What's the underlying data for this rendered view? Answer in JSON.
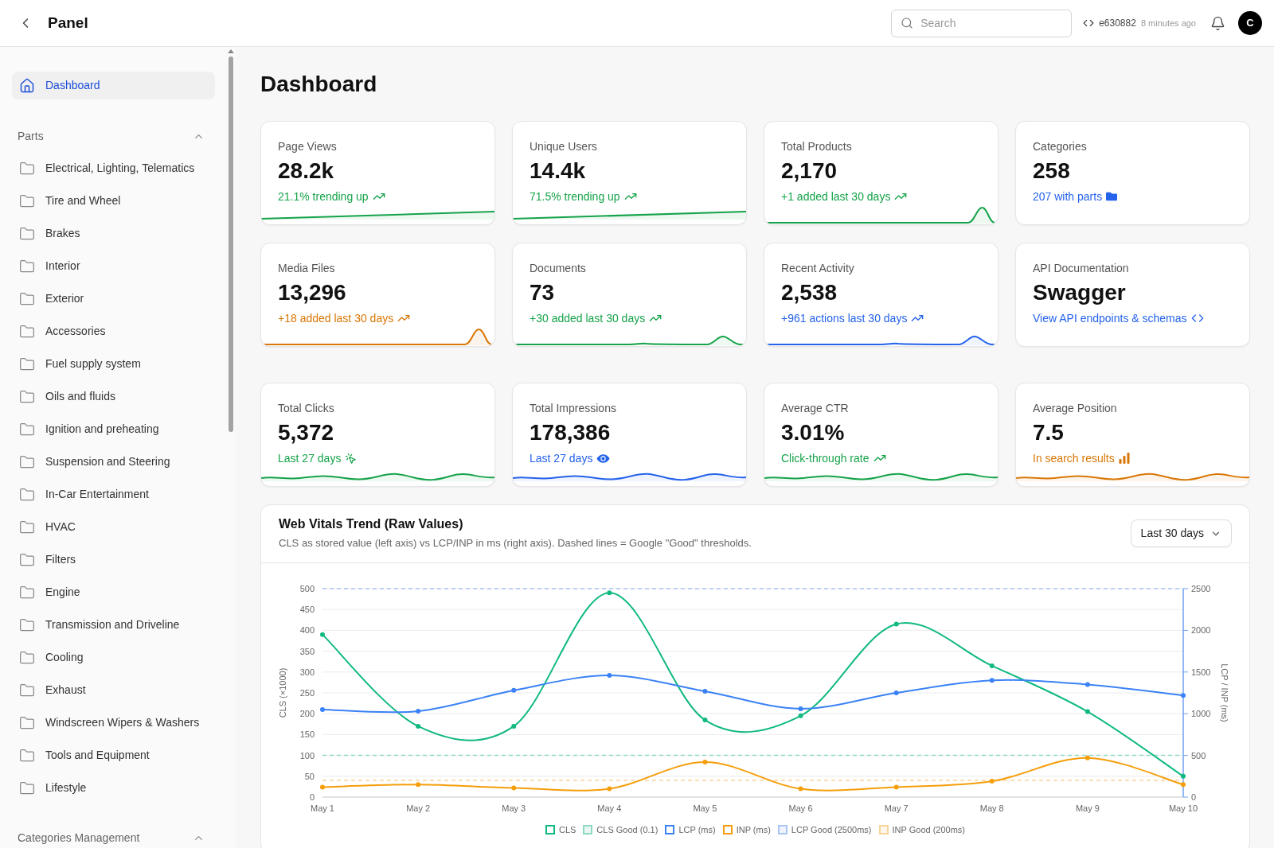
{
  "header": {
    "title": "Panel",
    "search": {
      "placeholder": "Search"
    },
    "commit": "e630882",
    "updated": "8 minutes ago",
    "avatar": "C"
  },
  "sidebar": {
    "items": [
      {
        "label": "Dashboard",
        "selected": true
      }
    ],
    "sections": [
      {
        "title": "Parts",
        "expanded": true,
        "items": [
          {
            "label": "Electrical, Lighting, Telematics",
            "selected": false
          },
          {
            "label": "Tire and Wheel",
            "selected": false
          },
          {
            "label": "Brakes",
            "selected": false
          },
          {
            "label": "Interior",
            "selected": false
          },
          {
            "label": "Exterior",
            "selected": false
          },
          {
            "label": "Accessories",
            "selected": false
          },
          {
            "label": "Fuel supply system",
            "selected": false
          },
          {
            "label": "Oils and fluids",
            "selected": false
          },
          {
            "label": "Ignition and preheating",
            "selected": false
          },
          {
            "label": "Suspension and Steering",
            "selected": false
          },
          {
            "label": "In-Car Entertainment",
            "selected": false
          },
          {
            "label": "HVAC",
            "selected": false
          },
          {
            "label": "Filters",
            "selected": false
          },
          {
            "label": "Engine",
            "selected": false
          },
          {
            "label": "Transmission and Driveline",
            "selected": false
          },
          {
            "label": "Cooling",
            "selected": false
          },
          {
            "label": "Exhaust",
            "selected": false
          },
          {
            "label": "Windscreen Wipers & Washers",
            "selected": false
          },
          {
            "label": "Tools and Equipment",
            "selected": false
          },
          {
            "label": "Lifestyle",
            "selected": false
          }
        ]
      },
      {
        "title": "Categories Management",
        "expanded": true
      }
    ]
  },
  "page": {
    "title": "Dashboard"
  },
  "overview_cards": [
    {
      "kind": "trend",
      "label": "Page Views",
      "value": "28.2k",
      "note": "21.1% trending up",
      "color": "#16a34a",
      "sparkline": {
        "kind": "rise"
      }
    },
    {
      "kind": "trend",
      "label": "Unique Users",
      "value": "14.4k",
      "note": "71.5% trending up",
      "color": "#16a34a",
      "sparkline": {
        "kind": "rise"
      }
    },
    {
      "kind": "trend",
      "label": "Total Products",
      "value": "2,170",
      "note": "+1 added last 30 days",
      "color": "#16a34a",
      "sparkline": {
        "kind": "spike"
      }
    },
    {
      "kind": "categories",
      "label": "Categories",
      "value": "258",
      "note": "207 with parts",
      "color": "#2563eb"
    },
    {
      "kind": "trend",
      "label": "Media Files",
      "value": "13,296",
      "note": "+18 added last 30 days",
      "color": "#d97706",
      "sparkline": {
        "kind": "spike"
      }
    },
    {
      "kind": "trend",
      "label": "Documents",
      "value": "73",
      "note": "+30 added last 30 days",
      "color": "#16a34a",
      "sparkline": {
        "kind": "bump"
      }
    },
    {
      "kind": "trend",
      "label": "Recent Activity",
      "value": "2,538",
      "note": "+961 actions last 30 days",
      "color": "#2563eb",
      "sparkline": {
        "kind": "bump"
      }
    },
    {
      "kind": "api",
      "label": "API Documentation",
      "value": "Swagger",
      "note": "View API endpoints & schemas",
      "color": "#2563eb"
    }
  ],
  "search_cards": [
    {
      "kind": "clicks",
      "label": "Total Clicks",
      "value": "5,372",
      "note": "Last 27 days",
      "color": "#16a34a",
      "sparkline": {
        "kind": "wave"
      }
    },
    {
      "kind": "impressions",
      "label": "Total Impressions",
      "value": "178,386",
      "note": "Last 27 days",
      "color": "#2563eb",
      "sparkline": {
        "kind": "wave"
      }
    },
    {
      "kind": "trend",
      "label": "Average CTR",
      "value": "3.01%",
      "note": "Click-through rate",
      "color": "#16a34a",
      "sparkline": {
        "kind": "wave"
      }
    },
    {
      "kind": "position",
      "label": "Average Position",
      "value": "7.5",
      "note": "In search results",
      "color": "#d97706",
      "sparkline": {
        "kind": "wave"
      }
    }
  ],
  "vitals": {
    "title": "Web Vitals Trend (Raw Values)",
    "subtitle": "CLS as stored value (left axis) vs LCP/INP in ms (right axis). Dashed lines = Google \"Good\" thresholds.",
    "range": "Last 30 days",
    "chart_data": {
      "type": "line",
      "ylabel": "CLS (×1000)",
      "y2label": "LCP / INP (ms)",
      "categories": [
        "May 1",
        "May 2",
        "May 3",
        "May 4",
        "May 5",
        "May 6",
        "May 7",
        "May 8",
        "May 9",
        "May 10"
      ],
      "ylim": [
        0,
        500
      ],
      "y2lim": [
        0,
        2500
      ],
      "yticks": [
        0,
        50,
        100,
        150,
        200,
        250,
        300,
        350,
        400,
        450,
        500
      ],
      "y2ticks": [
        0,
        500,
        1000,
        1500,
        2000,
        2500
      ],
      "grid": true,
      "legend": "bottom",
      "series": [
        {
          "name": "CLS",
          "color": "#10b981",
          "marker": true,
          "values": [
            390,
            170,
            170,
            490,
            185,
            195,
            415,
            315,
            205,
            50
          ]
        },
        {
          "name": "LCP (ms)",
          "color": "#3b82f6",
          "axis": "y2",
          "marker": true,
          "values": [
            1050,
            1030,
            1280,
            1460,
            1270,
            1060,
            1250,
            1400,
            1350,
            1220
          ]
        },
        {
          "name": "INP (ms)",
          "color": "#f59e0b",
          "axis": "y2",
          "marker": true,
          "values": [
            120,
            150,
            110,
            100,
            420,
            100,
            120,
            190,
            470,
            150
          ]
        }
      ],
      "ref_lines": [
        {
          "label": "CLS Good (0.1)",
          "value": 100,
          "axis": "y",
          "color": "#8fd9c4"
        },
        {
          "label": "LCP Good (2500ms)",
          "value": 2500,
          "axis": "y2",
          "color": "#a8c5f5"
        },
        {
          "label": "INP Good (200ms)",
          "value": 200,
          "axis": "y2",
          "color": "#f9d49a"
        }
      ]
    }
  }
}
